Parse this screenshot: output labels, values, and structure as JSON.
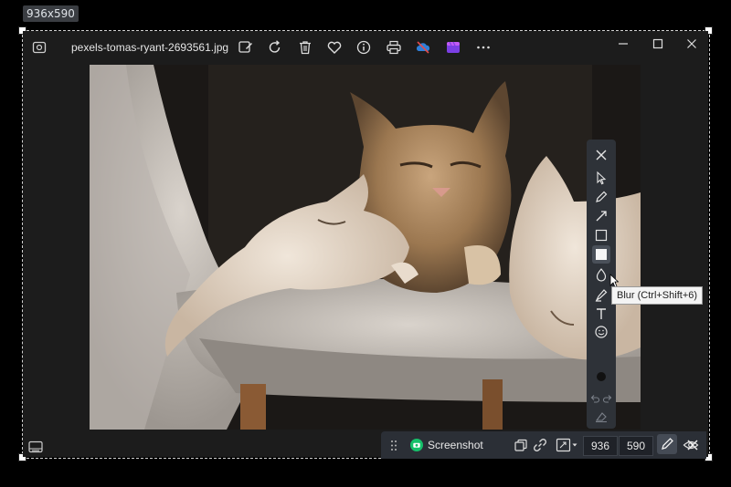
{
  "capture": {
    "size_badge": "936x590"
  },
  "window": {
    "filename": "pexels-tomas-ryant-2693561.jpg",
    "toolbar_icons": [
      "edit-icon",
      "rotate-icon",
      "delete-icon",
      "favorite-icon",
      "info-icon",
      "print-icon",
      "onedrive-icon",
      "clipchamp-icon",
      "more-icon"
    ],
    "window_controls": [
      "minimize-icon",
      "maximize-icon",
      "close-icon"
    ]
  },
  "annotation_tools": {
    "items": [
      "close",
      "select",
      "pen",
      "arrow",
      "rectangle",
      "filled-rectangle",
      "blur",
      "highlighter",
      "text",
      "sticker",
      "color",
      "undo",
      "redo",
      "clear"
    ],
    "selected": "filled-rectangle",
    "current_color": "#111111",
    "tooltip": "Blur (Ctrl+Shift+6)"
  },
  "capture_bar": {
    "mode_label": "Screenshot",
    "width": "936",
    "height": "590",
    "accent": "#16c06a"
  }
}
